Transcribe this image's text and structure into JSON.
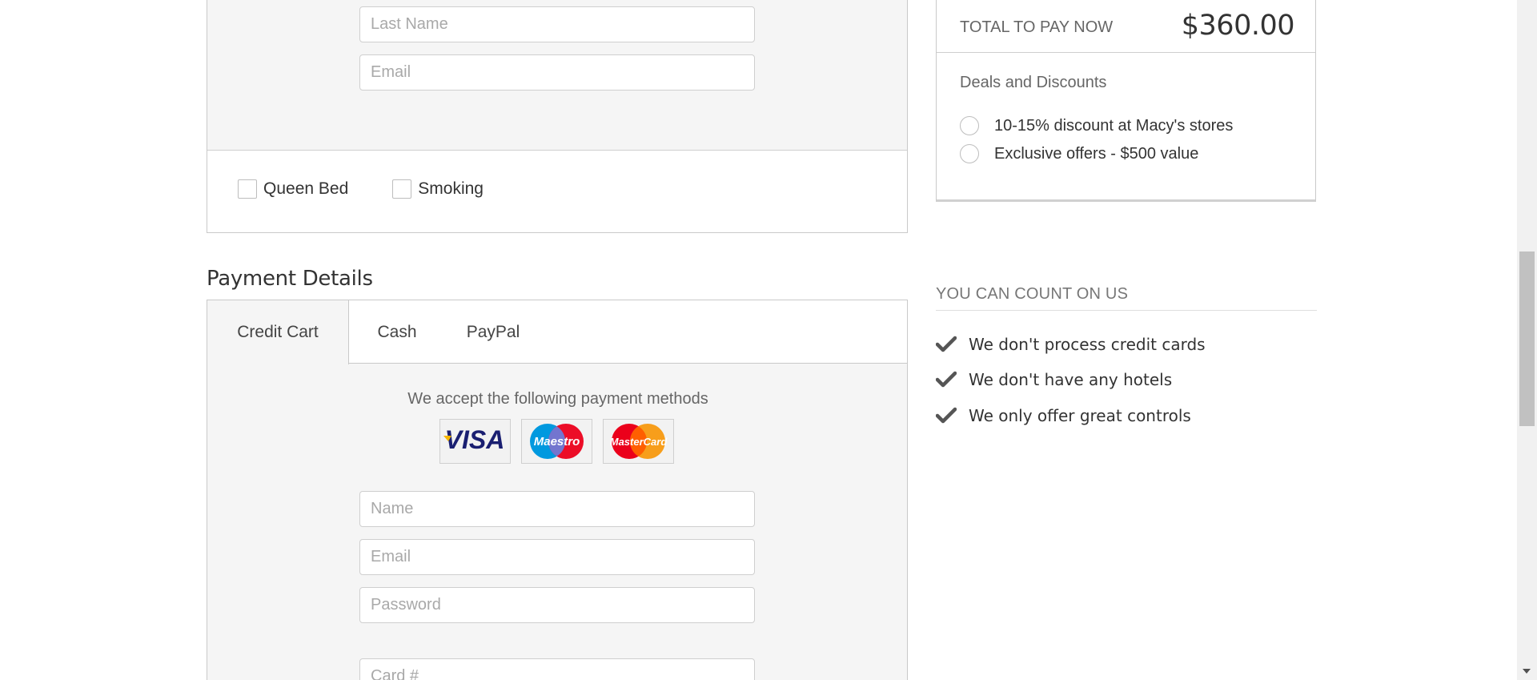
{
  "guest_form": {
    "last_name_placeholder": "Last Name",
    "email_placeholder": "Email",
    "options": {
      "queen_bed_label": "Queen Bed",
      "smoking_label": "Smoking"
    }
  },
  "payment": {
    "title": "Payment Details",
    "tabs": [
      {
        "label": "Credit Cart",
        "active": true
      },
      {
        "label": "Cash",
        "active": false
      },
      {
        "label": "PayPal",
        "active": false
      }
    ],
    "accept_text": "We accept the following payment methods",
    "card_logos": [
      {
        "name": "VISA",
        "icon": "visa-logo"
      },
      {
        "name": "Maestro",
        "icon": "maestro-logo"
      },
      {
        "name": "MasterCard",
        "icon": "mastercard-logo"
      }
    ],
    "fields": {
      "name_placeholder": "Name",
      "email_placeholder": "Email",
      "password_placeholder": "Password",
      "card_placeholder": "Card #"
    }
  },
  "summary": {
    "total_label": "TOTAL TO PAY NOW",
    "total_value": "$360.00",
    "deals_title": "Deals and Discounts",
    "deals": [
      {
        "label": "10-15% discount at Macy's stores"
      },
      {
        "label": "Exclusive offers - $500 value"
      }
    ]
  },
  "assurance": {
    "title": "YOU CAN COUNT ON US",
    "items": [
      {
        "label": "We don't process credit cards",
        "icon": "check-icon"
      },
      {
        "label": "We don't have any hotels",
        "icon": "check-icon"
      },
      {
        "label": "We only offer great controls",
        "icon": "check-icon"
      }
    ]
  },
  "colors": {
    "panel_bg": "#f5f5f5",
    "border": "#c9c9c9",
    "visa_blue": "#1a1f71",
    "visa_gold": "#f7b600",
    "maestro_blue": "#0099df",
    "maestro_red": "#eb001b",
    "mastercard_red": "#eb001b",
    "mastercard_orange": "#f79e1b"
  }
}
